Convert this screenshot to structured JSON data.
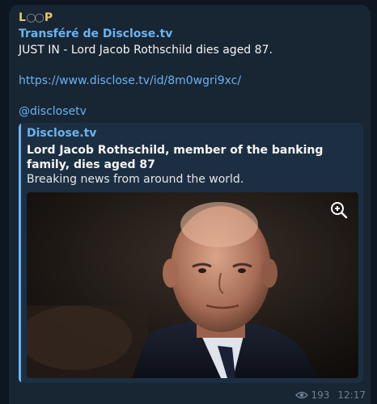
{
  "message": {
    "channel_name": "LOOP",
    "forwarded_from": "Transféré de Disclose.tv",
    "text": "JUST IN - Lord Jacob Rothschild dies aged 87.",
    "link": "https://www.disclose.tv/id/8m0wgri9xc/",
    "handle": "@disclosetv"
  },
  "preview": {
    "site": "Disclose.tv",
    "title": "Lord Jacob Rothschild, member of the banking family, dies aged 87",
    "description": "Breaking news from around the world."
  },
  "footer": {
    "views": "193",
    "time": "12:17"
  },
  "icons": {
    "zoom": "zoom-in-icon",
    "views": "eye-icon"
  },
  "colors": {
    "background": "#0e1621",
    "bubble": "#182533",
    "accent": "#6ab3f3"
  }
}
